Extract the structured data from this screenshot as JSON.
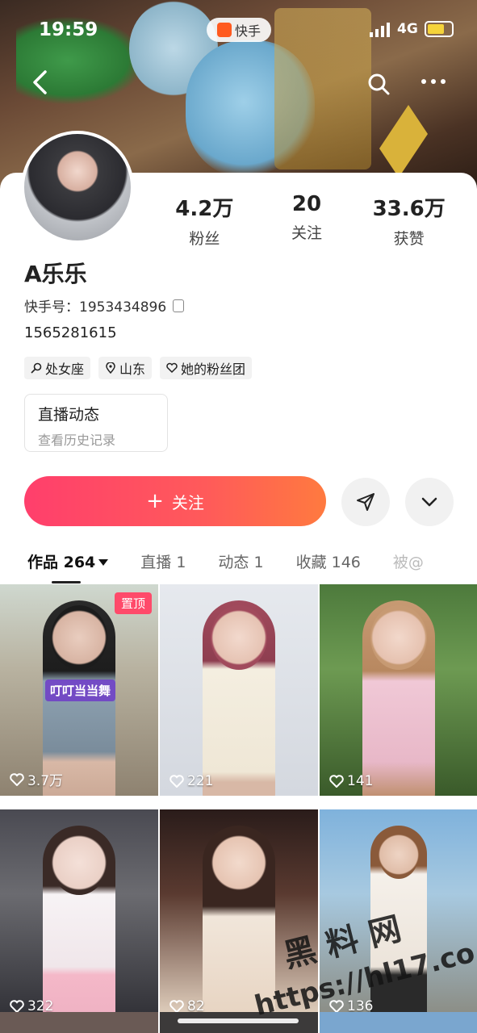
{
  "status_bar": {
    "time": "19:59",
    "app_name": "快手",
    "network": "4G"
  },
  "header": {
    "back_icon": "chevron-left-icon",
    "search_icon": "search-icon",
    "more_icon": "more-horizontal-icon"
  },
  "profile": {
    "followers_count": "4.2万",
    "followers_label": "粉丝",
    "following_count": "20",
    "following_label": "关注",
    "likes_count": "33.6万",
    "likes_label": "获赞",
    "name": "A乐乐",
    "kuaishou_id_label": "快手号：",
    "kuaishou_id": "1953434896",
    "bio": "1565281615",
    "tags": [
      "处女座",
      "山东",
      "她的粉丝团"
    ]
  },
  "live_box": {
    "title": "直播动态",
    "subtitle": "查看历史记录"
  },
  "actions": {
    "follow_label": "关注",
    "share_icon": "send-icon",
    "dropdown_icon": "chevron-down-icon"
  },
  "tabs": {
    "works": "作品 264",
    "live": "直播 1",
    "moments": "动态 1",
    "favorites": "收藏 146",
    "more": "被@"
  },
  "grid": [
    {
      "likes": "3.7万",
      "pinned": "置顶",
      "caption": "叮叮当当舞"
    },
    {
      "likes": "221"
    },
    {
      "likes": "141"
    },
    {
      "likes": "322"
    },
    {
      "likes": "82"
    },
    {
      "likes": "136"
    }
  ],
  "watermark": {
    "line1": "黑料网",
    "line2": "https://hl17.co"
  },
  "colors": {
    "follow_gradient_start": "#ff3f6c",
    "follow_gradient_end": "#ff7a3f",
    "pin_badge": "#ff4a6a"
  }
}
